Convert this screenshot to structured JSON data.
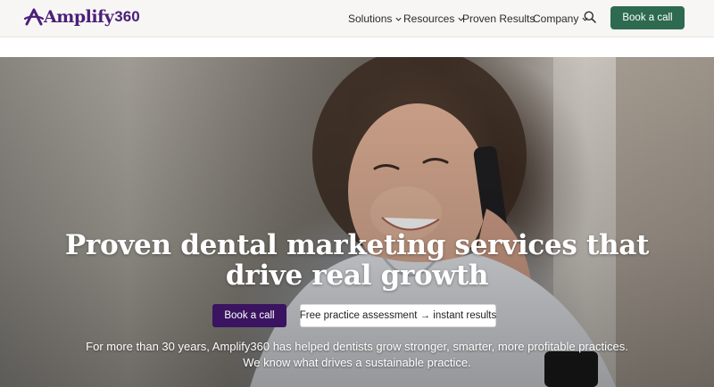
{
  "header": {
    "logo": {
      "text": "Amplify",
      "number": "360",
      "color": "#4a1f7a"
    },
    "nav": [
      {
        "label": "Solutions",
        "has_dropdown": true
      },
      {
        "label": "Resources",
        "has_dropdown": true
      },
      {
        "label": "Proven Results",
        "has_dropdown": false
      },
      {
        "label": "Company",
        "has_dropdown": true
      }
    ],
    "search_icon": "search-icon",
    "cta_label": "Book a call",
    "cta_color": "#2d6a4f"
  },
  "hero": {
    "title_line1": "Proven dental marketing services that",
    "title_line2": "drive real growth",
    "primary_cta": "Book a call",
    "primary_color": "#3a1460",
    "secondary_cta": "Free practice assessment → instant results",
    "subtitle_line1": "For more than 30 years, Amplify360 has helped dentists grow stronger, smarter, more profitable practices.",
    "subtitle_line2": "We know what drives a sustainable practice."
  }
}
